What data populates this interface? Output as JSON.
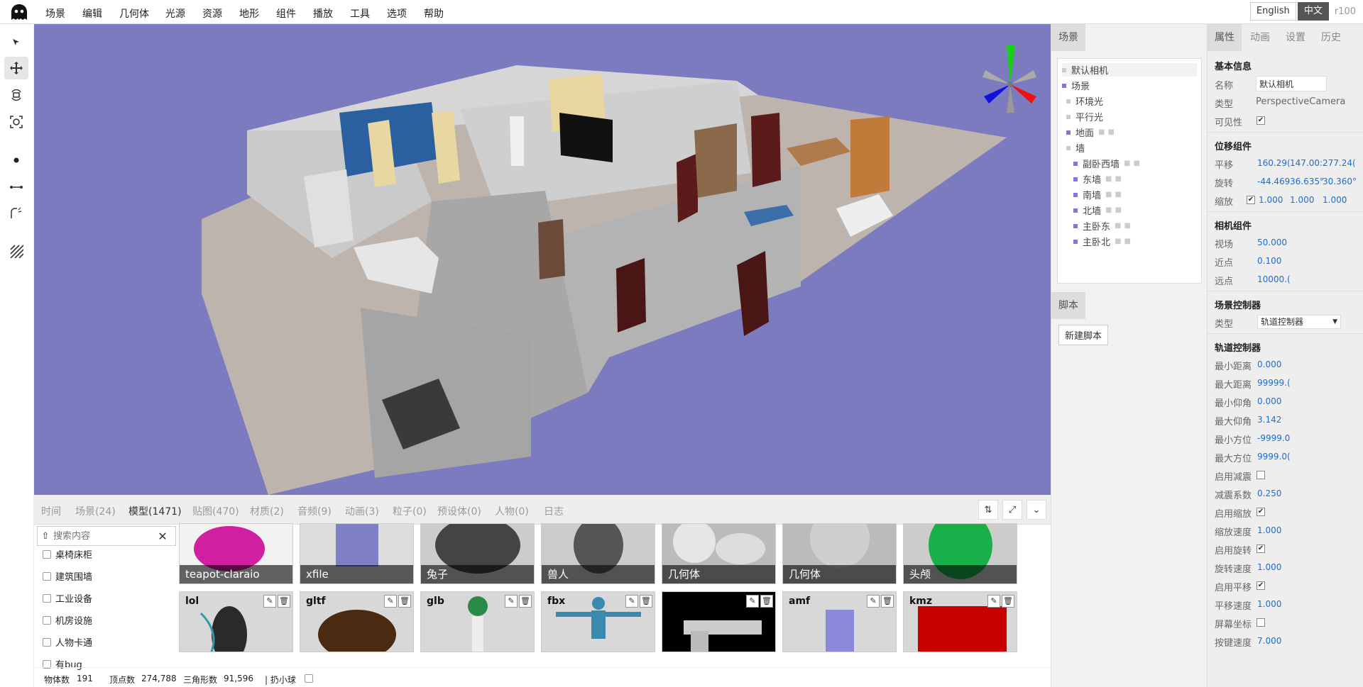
{
  "menu": {
    "items": [
      "场景",
      "编辑",
      "几何体",
      "光源",
      "资源",
      "地形",
      "组件",
      "播放",
      "工具",
      "选项",
      "帮助"
    ],
    "lang_en": "English",
    "lang_zh": "中文",
    "revision": "r100"
  },
  "bottom": {
    "tabs": [
      "时间",
      "场景(24)",
      "模型(1471)",
      "贴图(470)",
      "材质(2)",
      "音频(9)",
      "动画(3)",
      "粒子(0)",
      "预设体(0)",
      "人物(0)",
      "日志"
    ],
    "active_tab": "模型(1471)",
    "search_placeholder": "搜索内容",
    "categories": [
      "桌椅床柜",
      "建筑围墙",
      "工业设备",
      "机房设施",
      "人物卡通",
      "有bug"
    ],
    "row1": [
      "teapot-claraio",
      "xfile",
      "兔子",
      "兽人",
      "几何体",
      "几何体",
      "头颅"
    ],
    "row2": [
      "lol",
      "gltf",
      "glb",
      "fbx",
      "",
      "amf",
      "kmz"
    ],
    "status": {
      "objects_label": "物体数",
      "objects": "191",
      "vertices_label": "顶点数",
      "vertices": "274,788",
      "triangles_label": "三角形数",
      "triangles": "91,596",
      "throw_label": "| 扔小球"
    }
  },
  "scene_panel": {
    "tab": "场景",
    "nodes": [
      "默认相机",
      "场景",
      "环境光",
      "平行光",
      "地面",
      "墙",
      "副卧西墙",
      "东墙",
      "南墙",
      "北墙",
      "主卧东",
      "主卧北"
    ],
    "script_tab": "脚本",
    "new_script": "新建脚本"
  },
  "props": {
    "tabs": [
      "属性",
      "动画",
      "设置",
      "历史"
    ],
    "basic_title": "基本信息",
    "name_label": "名称",
    "name_value": "默认相机",
    "type_label": "类型",
    "type_value": "PerspectiveCamera",
    "visible_label": "可见性",
    "transform_title": "位移组件",
    "pos_label": "平移",
    "pos": [
      "160.29(",
      "147.00:",
      "277.24("
    ],
    "rot_label": "旋转",
    "rot": [
      "-44.469",
      "36.635°",
      "30.360°"
    ],
    "scale_label": "缩放",
    "scale": [
      "1.000",
      "1.000",
      "1.000"
    ],
    "camera_title": "相机组件",
    "fov_label": "视场",
    "fov": "50.000",
    "near_label": "近点",
    "near": "0.100",
    "far_label": "远点",
    "far": "10000.(",
    "controller_title": "场景控制器",
    "controller_type_label": "类型",
    "controller_type": "轨道控制器",
    "orbit_title": "轨道控制器",
    "orbit": [
      [
        "最小距离",
        "0.000"
      ],
      [
        "最大距离",
        "99999.("
      ],
      [
        "最小仰角",
        "0.000"
      ],
      [
        "最大仰角",
        "3.142"
      ],
      [
        "最小方位",
        "-9999.0"
      ],
      [
        "最大方位",
        "9999.0("
      ],
      [
        "启用减震",
        ""
      ],
      [
        "减震系数",
        "0.250"
      ],
      [
        "启用缩放",
        "✔"
      ],
      [
        "缩放速度",
        "1.000"
      ],
      [
        "启用旋转",
        "✔"
      ],
      [
        "旋转速度",
        "1.000"
      ],
      [
        "启用平移",
        "✔"
      ],
      [
        "平移速度",
        "1.000"
      ],
      [
        "屏幕坐标",
        ""
      ],
      [
        "按键速度",
        "7.000"
      ]
    ]
  }
}
